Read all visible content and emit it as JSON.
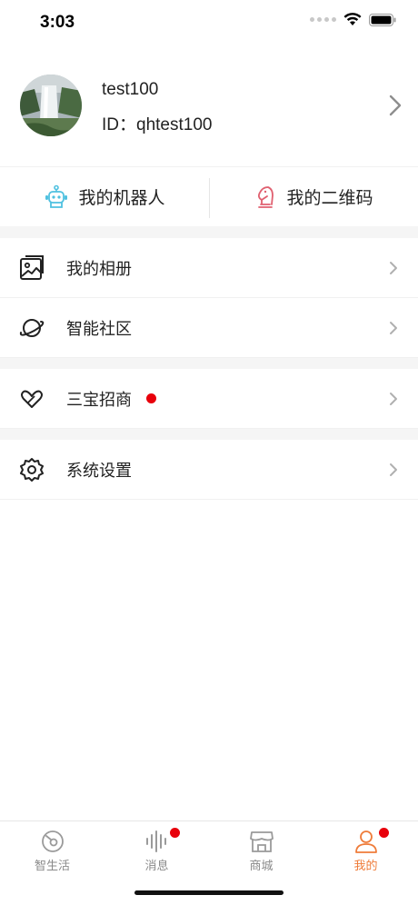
{
  "status_bar": {
    "time": "3:03"
  },
  "profile": {
    "name": "test100",
    "id_text": "ID：qhtest100"
  },
  "quick_actions": [
    {
      "label": "我的机器人",
      "icon": "robot-icon"
    },
    {
      "label": "我的二维码",
      "icon": "chess-knight-icon"
    }
  ],
  "menu": {
    "album": {
      "label": "我的相册",
      "icon": "photo-album-icon"
    },
    "community": {
      "label": "智能社区",
      "icon": "planet-icon"
    },
    "sanbao": {
      "label": "三宝招商",
      "icon": "hearts-icon",
      "has_badge": true
    },
    "settings": {
      "label": "系统设置",
      "icon": "gear-icon"
    }
  },
  "tabbar": [
    {
      "label": "智生活",
      "icon": "smart-life-icon",
      "active": false,
      "badge": false
    },
    {
      "label": "消息",
      "icon": "sound-wave-icon",
      "active": false,
      "badge": true
    },
    {
      "label": "商城",
      "icon": "shop-icon",
      "active": false,
      "badge": false
    },
    {
      "label": "我的",
      "icon": "person-icon",
      "active": true,
      "badge": true
    }
  ],
  "colors": {
    "accent": "#ef7c3a",
    "badge": "#e8000b",
    "robot_icon": "#4fc1e0",
    "qr_icon": "#e06070"
  }
}
